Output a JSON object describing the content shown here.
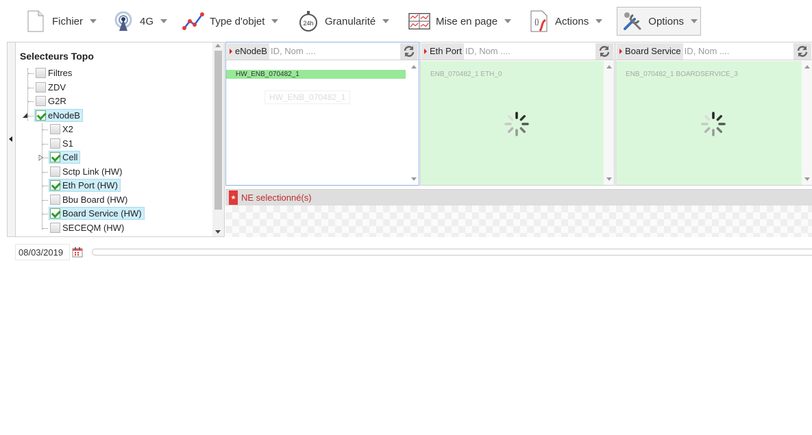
{
  "toolbar": {
    "file_label": "Fichier",
    "network_label": "4G",
    "object_type_label": "Type d'objet",
    "granularity_label": "Granularité",
    "granularity_icon_text": "24h",
    "layout_label": "Mise en page",
    "actions_label": "Actions",
    "options_label": "Options"
  },
  "tree": {
    "title": "Selecteurs Topo",
    "nodes": [
      {
        "label": "Filtres",
        "checked": false
      },
      {
        "label": "ZDV",
        "checked": false
      },
      {
        "label": "G2R",
        "checked": false
      },
      {
        "label": "eNodeB",
        "checked": true
      },
      {
        "label": "X2",
        "checked": false
      },
      {
        "label": "S1",
        "checked": false
      },
      {
        "label": "Cell",
        "checked": true
      },
      {
        "label": "Sctp Link (HW)",
        "checked": false
      },
      {
        "label": "Eth Port (HW)",
        "checked": true
      },
      {
        "label": "Bbu Board (HW)",
        "checked": false
      },
      {
        "label": "Board Service (HW)",
        "checked": true
      },
      {
        "label": "SECEQM (HW)",
        "checked": false
      }
    ]
  },
  "columns": [
    {
      "tag": "eNodeB",
      "placeholder": "ID, Nom ....",
      "items": [
        "HW_ENB_070482_1"
      ],
      "drag_ghost": "HW_ENB_070482_1",
      "loading": false
    },
    {
      "tag": "Eth Port",
      "placeholder": "ID, Nom ....",
      "items": [
        "ENB_070482_1 ETH_0"
      ],
      "loading": true
    },
    {
      "tag": "Board Service",
      "placeholder": "ID, Nom ....",
      "items": [
        "ENB_070482_1 BOARDSERVICE_3"
      ],
      "loading": true
    }
  ],
  "selection": {
    "label": "NE selectionné(s)"
  },
  "date": {
    "value": "08/03/2019"
  },
  "colors": {
    "selected_bg": "#cdeefb",
    "check_green": "#2e9a2e",
    "loading_bg": "#dbf7db",
    "selected_row": "#98e898",
    "accent_red": "#d22222"
  }
}
